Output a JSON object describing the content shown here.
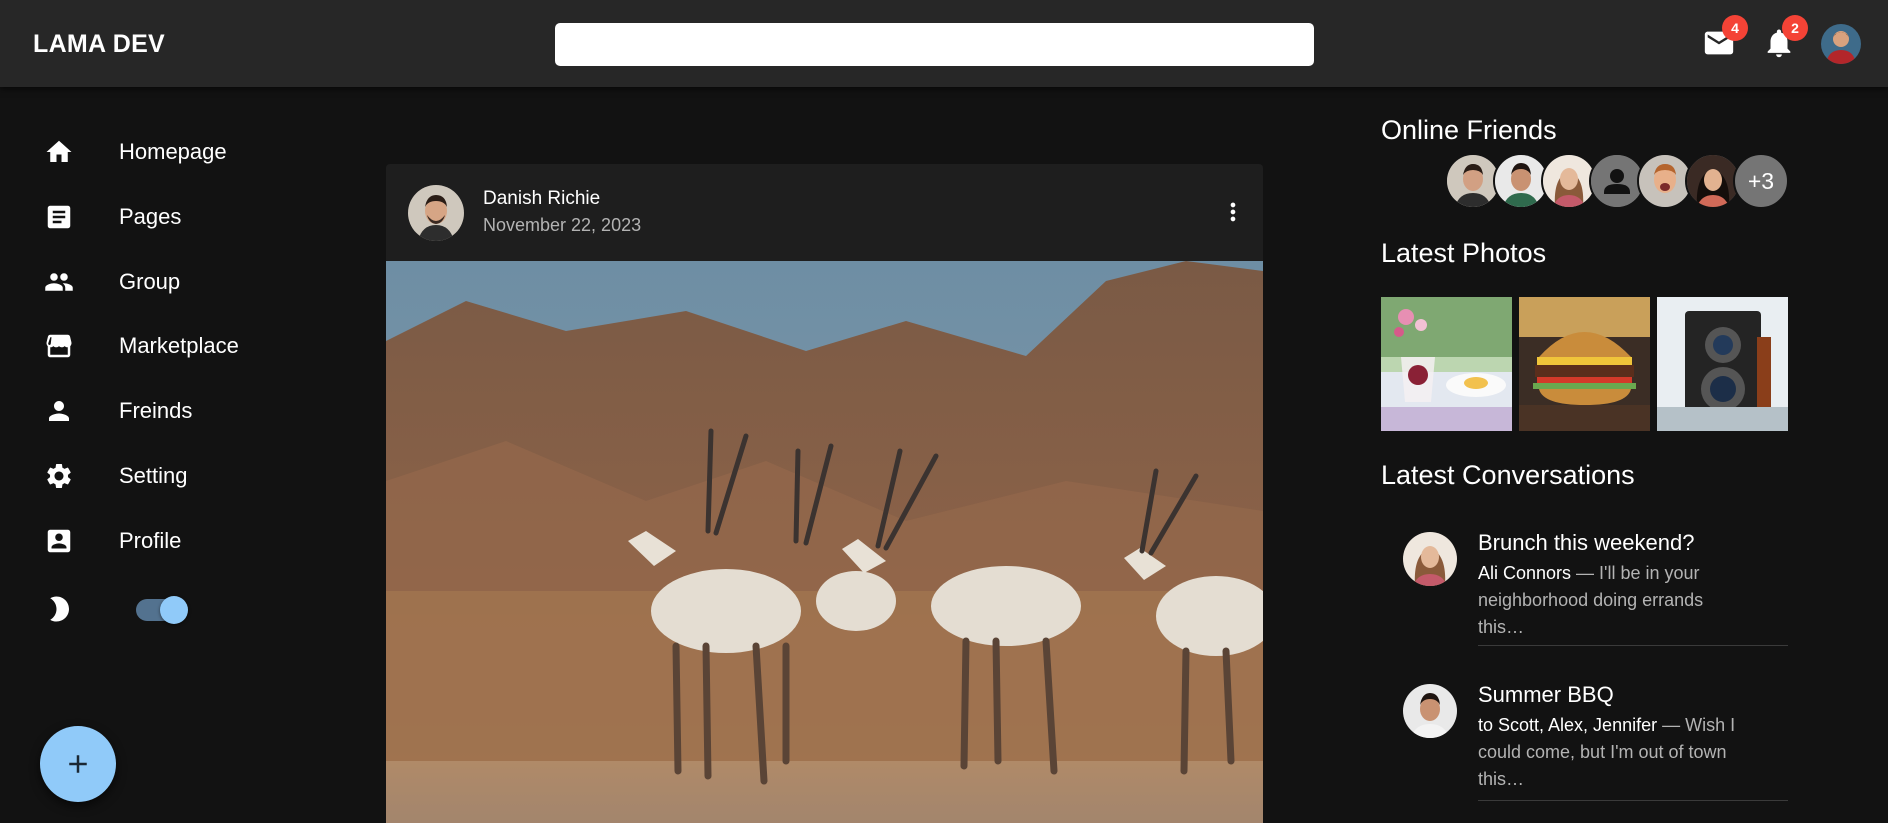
{
  "header": {
    "logo": "LAMA DEV",
    "search_value": "",
    "search_placeholder": "",
    "mail_badge": "4",
    "notification_badge": "2"
  },
  "sidebar": {
    "items": [
      {
        "label": "Homepage",
        "icon": "home-icon"
      },
      {
        "label": "Pages",
        "icon": "article-icon"
      },
      {
        "label": "Group",
        "icon": "group-icon"
      },
      {
        "label": "Marketplace",
        "icon": "storefront-icon"
      },
      {
        "label": "Freinds",
        "icon": "person-icon"
      },
      {
        "label": "Setting",
        "icon": "gear-icon"
      },
      {
        "label": "Profile",
        "icon": "account-box-icon"
      }
    ],
    "dark_mode_on": true
  },
  "post": {
    "author": "Danish Richie",
    "date": "November 22, 2023"
  },
  "rightbar": {
    "online_friends_title": "Online Friends",
    "more_friends": "+3",
    "latest_photos_title": "Latest Photos",
    "latest_conversations_title": "Latest Conversations",
    "conversations": [
      {
        "title": "Brunch this weekend?",
        "sender": "Ali Connors",
        "line1": " — I'll be in your",
        "line2": "neighborhood doing errands",
        "line3": "this…"
      },
      {
        "title": "Summer BBQ",
        "sender": "to Scott, Alex, Jennifer",
        "line1": " — Wish I",
        "line2": "could come, but I'm out of town",
        "line3": "this…"
      }
    ]
  },
  "colors": {
    "accent": "#90caf9",
    "badge": "#f44336",
    "topbar": "#272727",
    "background": "#121212",
    "card": "#1e1e1e"
  }
}
